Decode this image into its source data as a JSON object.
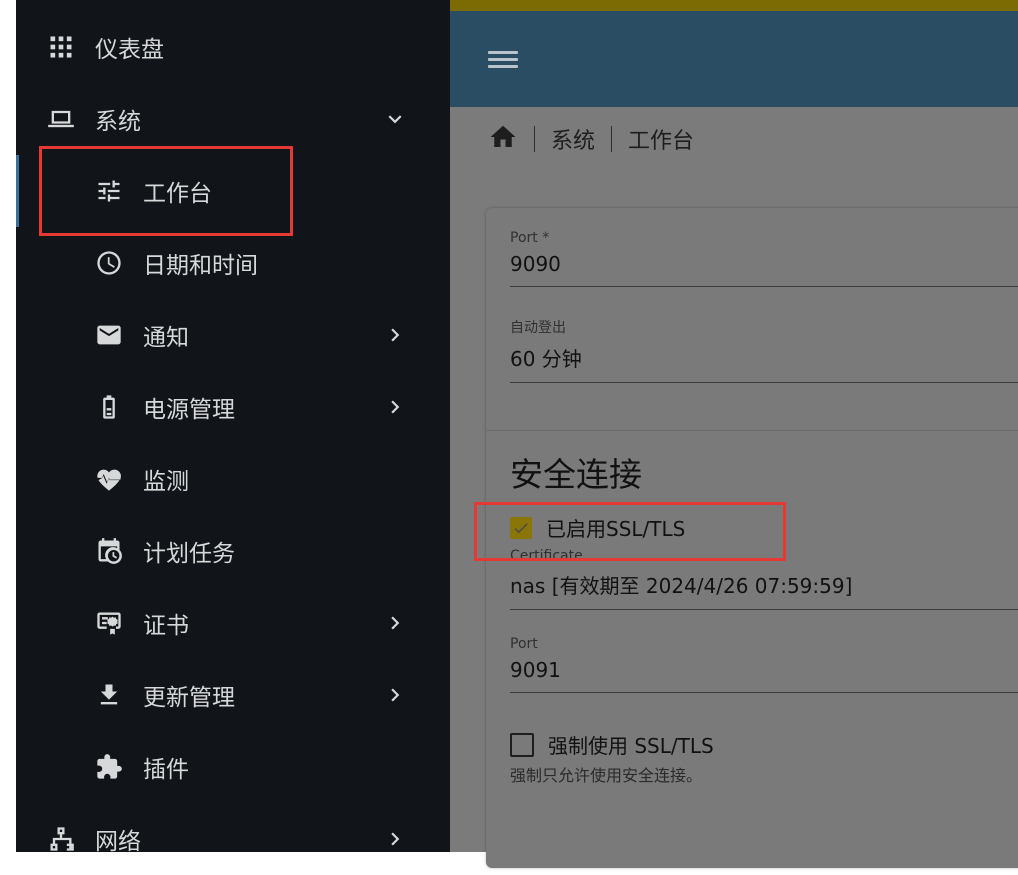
{
  "sidebar": {
    "items": [
      {
        "label": "仪表盘",
        "icon": "grid-icon"
      },
      {
        "label": "系统",
        "icon": "laptop-icon"
      },
      {
        "label": "工作台",
        "icon": "tune-icon"
      },
      {
        "label": "日期和时间",
        "icon": "clock-icon"
      },
      {
        "label": "通知",
        "icon": "mail-icon"
      },
      {
        "label": "电源管理",
        "icon": "battery-icon"
      },
      {
        "label": "监测",
        "icon": "heart-pulse-icon"
      },
      {
        "label": "计划任务",
        "icon": "calendar-clock-icon"
      },
      {
        "label": "证书",
        "icon": "certificate-icon"
      },
      {
        "label": "更新管理",
        "icon": "download-icon"
      },
      {
        "label": "插件",
        "icon": "puzzle-icon"
      },
      {
        "label": "网络",
        "icon": "network-icon"
      }
    ]
  },
  "breadcrumb": {
    "items": [
      "系统",
      "工作台"
    ]
  },
  "form": {
    "port_label": "Port *",
    "port_value": "9090",
    "autologout_label": "自动登出",
    "autologout_value": "60 分钟",
    "secure_title": "安全连接",
    "ssl_enabled_label": "已启用SSL/TLS",
    "ssl_enabled_checked": true,
    "certificate_label": "Certificate",
    "certificate_value": "nas [有效期至 2024/4/26 07:59:59]",
    "ssl_port_label": "Port",
    "ssl_port_value": "9091",
    "force_ssl_label": "强制使用 SSL/TLS",
    "force_ssl_checked": false,
    "force_ssl_hint": "强制只允许使用安全连接。"
  },
  "colors": {
    "sidebar_bg": "#111519",
    "topbar": "#2b4d64",
    "accent": "#8a7606",
    "highlight": "#e53935"
  }
}
